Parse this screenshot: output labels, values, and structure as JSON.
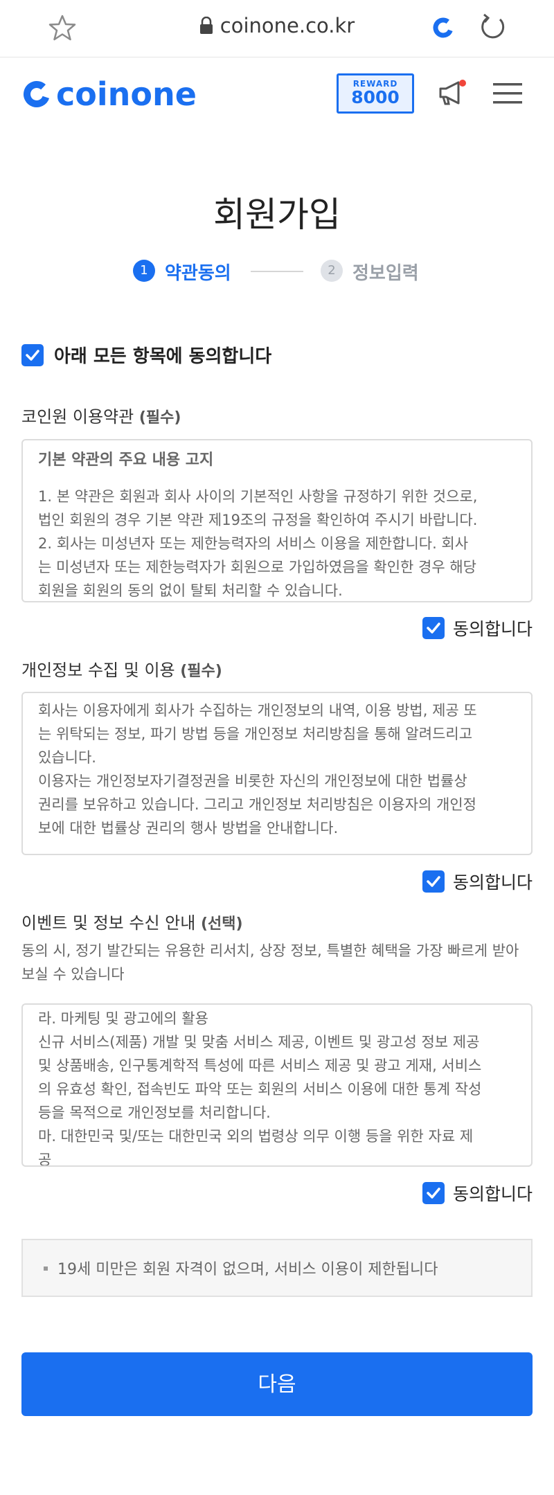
{
  "browser": {
    "url": "coinone.co.kr"
  },
  "header": {
    "logo_text": "coinone",
    "reward_label": "REWARD",
    "reward_value": "8000"
  },
  "page": {
    "title": "회원가입"
  },
  "steps": [
    {
      "number": "1",
      "label": "약관동의",
      "active": true
    },
    {
      "number": "2",
      "label": "정보입력",
      "active": false
    }
  ],
  "agree_all": {
    "label": "아래 모든 항목에 동의합니다",
    "checked": true
  },
  "sections": [
    {
      "title": "코인원 이용약관",
      "tag": "(필수)",
      "heading": "기본 약관의 주요 내용 고지",
      "lines": [
        "1. 본 약관은 회원과 회사 사이의 기본적인 사항을 규정하기 위한 것으로,",
        "법인 회원의 경우 기본 약관 제19조의 규정을 확인하여 주시기 바랍니다.",
        "2. 회사는 미성년자 또는 제한능력자의 서비스 이용을 제한합니다. 회사",
        "는 미성년자 또는 제한능력자가 회원으로 가입하였음을 확인한 경우 해당",
        "회원을 회원의 동의 없이 탈퇴 처리할 수 있습니다."
      ],
      "agree_label": "동의합니다",
      "checked": true
    },
    {
      "title": "개인정보 수집 및 이용",
      "tag": "(필수)",
      "lines": [
        "회사는 이용자에게 회사가 수집하는 개인정보의 내역, 이용 방법, 제공 또",
        "는 위탁되는 정보, 파기 방법 등을 개인정보 처리방침을 통해 알려드리고",
        "있습니다.",
        "이용자는 개인정보자기결정권을 비롯한 자신의 개인정보에 대한 법률상",
        "권리를 보유하고 있습니다. 그리고 개인정보 처리방침은 이용자의 개인정",
        "보에 대한 법률상 권리의 행사 방법을 안내합니다."
      ],
      "agree_label": "동의합니다",
      "checked": true
    },
    {
      "title": "이벤트 및 정보 수신 안내",
      "tag": "(선택)",
      "description": "동의 시, 정기 발간되는 유용한 리서치, 상장 정보, 특별한 혜택을 가장 빠르게 받아 보실 수 있습니다",
      "lines": [
        "라. 마케팅 및 광고에의 활용",
        "신규 서비스(제품) 개발 및 맞춤 서비스 제공, 이벤트 및 광고성 정보 제공",
        "및 상품배송, 인구통계학적 특성에 따른 서비스 제공 및 광고 게재, 서비스",
        "의 유효성 확인, 접속빈도 파악 또는 회원의 서비스 이용에 대한 통계 작성",
        "등을 목적으로 개인정보를 처리합니다.",
        "마. 대한민국 및/또는 대한민국 외의 법령상 의무 이행 등을 위한 자료 제",
        "공"
      ],
      "agree_label": "동의합니다",
      "checked": true
    }
  ],
  "notice": {
    "text": "19세 미만은 회원 자격이 없으며, 서비스 이용이 제한됩니다"
  },
  "next_button": {
    "label": "다음"
  },
  "colors": {
    "brand": "#1a6ff0",
    "notification_dot": "#f0453a"
  }
}
